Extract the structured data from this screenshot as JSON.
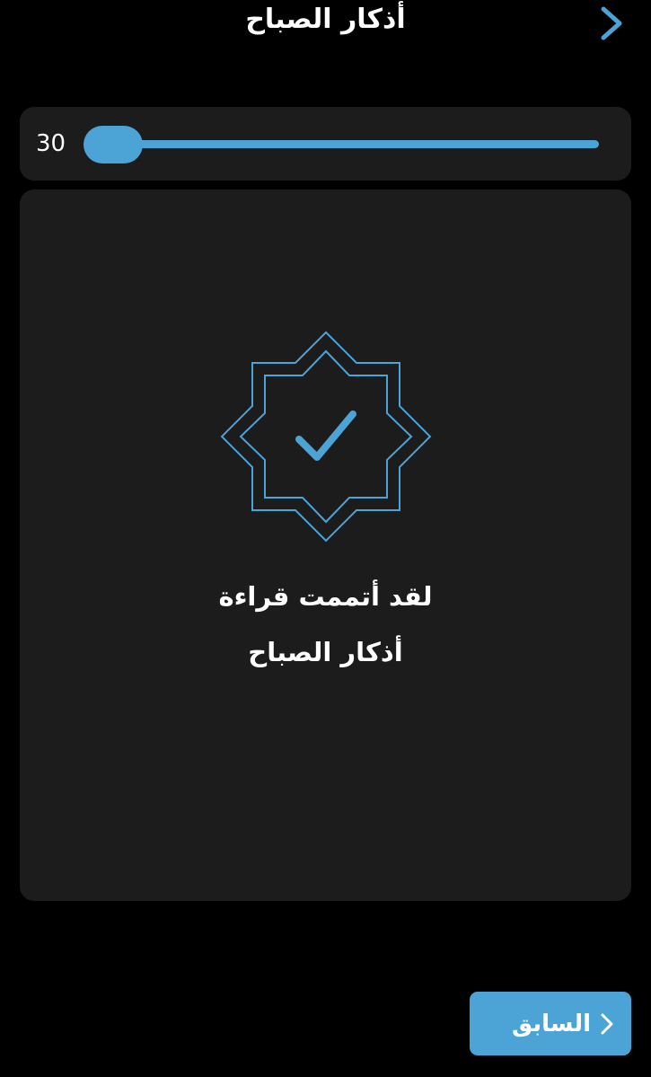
{
  "header": {
    "title": "أذكار الصباح",
    "back_icon": "chevron-right-icon"
  },
  "slider": {
    "value_label": "30",
    "level_fraction": 0.0
  },
  "completion": {
    "icon": "check-badge-icon",
    "line1": "لقد أتممت قراءة",
    "line2": "أذكار الصباح"
  },
  "footer": {
    "previous_label": "السابق",
    "previous_icon": "chevron-right-icon"
  },
  "colors": {
    "background": "#000000",
    "card": "#1c1c1d",
    "accent": "#4ba3d6",
    "text": "#ffffff"
  }
}
